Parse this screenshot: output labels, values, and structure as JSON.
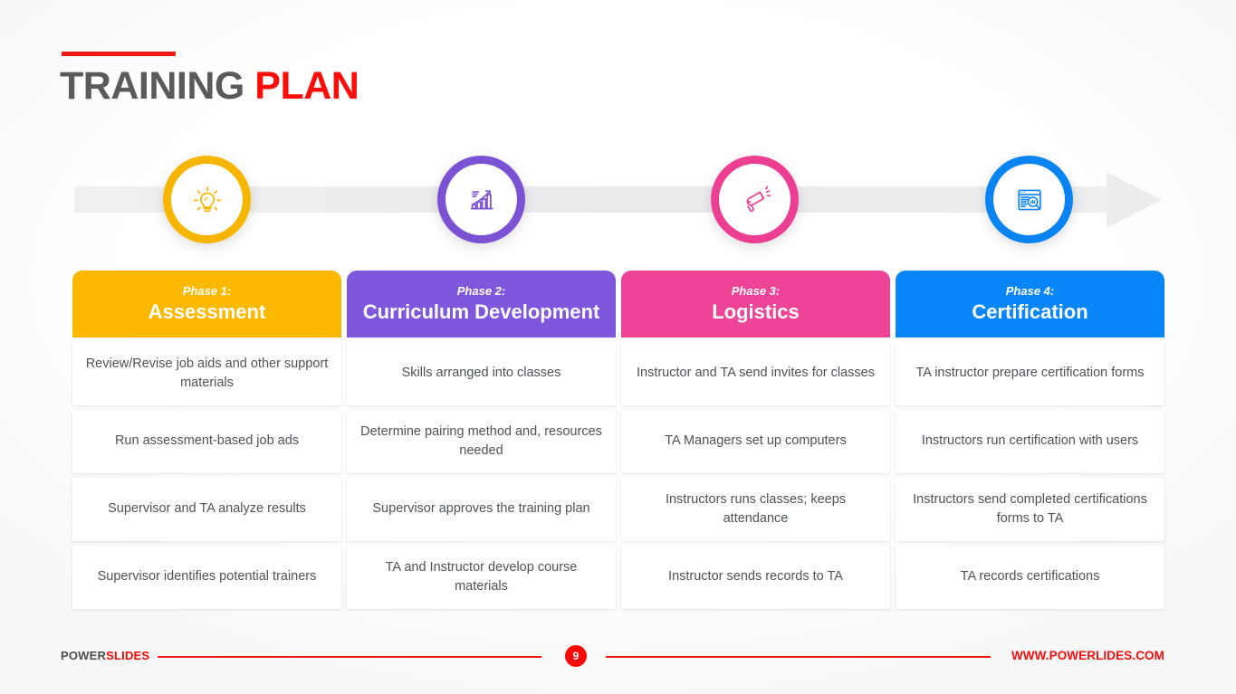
{
  "title": {
    "part1": "TRAINING",
    "part2": "PLAN"
  },
  "icons": [
    {
      "name": "lightbulb-icon",
      "color": "#F7B500"
    },
    {
      "name": "growth-chart-icon",
      "color": "#7B52D3"
    },
    {
      "name": "megaphone-icon",
      "color": "#EC3F93"
    },
    {
      "name": "document-search-icon",
      "color": "#0B84F3"
    }
  ],
  "columns": [
    {
      "phase_label": "Phase 1:",
      "phase_name": "Assessment",
      "color": "#FCB900",
      "items": [
        "Review/Revise job aids and other support materials",
        "Run assessment-based job ads",
        "Supervisor and TA analyze results",
        "Supervisor identifies potential trainers"
      ]
    },
    {
      "phase_label": "Phase 2:",
      "phase_name": "Curriculum Development",
      "color": "#7E57DC",
      "items": [
        "Skills arranged into classes",
        "Determine pairing method and, resources needed",
        "Supervisor approves the training plan",
        "TA and Instructor develop course materials"
      ]
    },
    {
      "phase_label": "Phase 3:",
      "phase_name": "Logistics",
      "color": "#EE4498",
      "items": [
        "Instructor and TA send invites for classes",
        "TA Managers set up computers",
        "Instructors runs classes; keeps attendance",
        "Instructor sends records to TA"
      ]
    },
    {
      "phase_label": "Phase 4:",
      "phase_name": "Certification",
      "color": "#0886F7",
      "items": [
        "TA instructor prepare certification forms",
        "Instructors run certification with users",
        "Instructors send completed certifications forms to TA",
        "TA records certifications"
      ]
    }
  ],
  "footer": {
    "brand_part1": "POWER",
    "brand_part2": "SLIDES",
    "page_number": "9",
    "website": "WWW.POWERLIDES.COM"
  }
}
